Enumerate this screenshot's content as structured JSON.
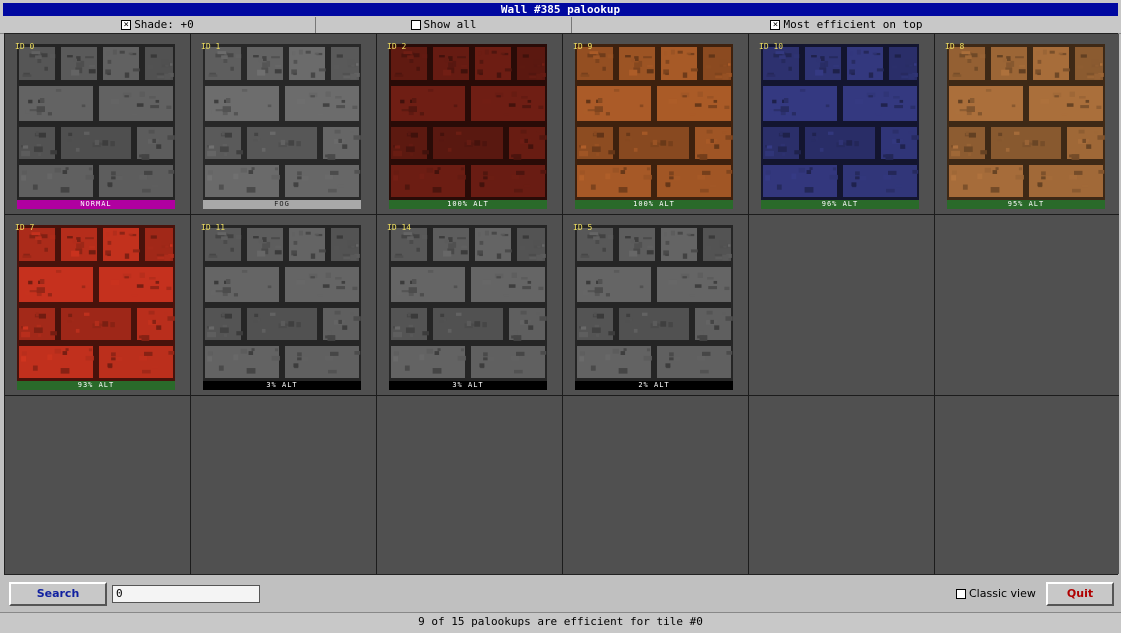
{
  "window": {
    "title": "Wall #385 palookup"
  },
  "options": {
    "shade": {
      "label": "Shade: +0",
      "checked": true
    },
    "show_all": {
      "label": "Show all",
      "checked": false
    },
    "most_efficient": {
      "label": "Most efficient on top",
      "checked": true
    }
  },
  "tiles": [
    {
      "id": "ID 0",
      "label": "NORMAL",
      "label_color": "#b000a0",
      "base": "#505050"
    },
    {
      "id": "ID 1",
      "label": "FOG",
      "label_color": "#a8a8a8",
      "base": "#585858"
    },
    {
      "id": "ID 2",
      "label": "100% ALT",
      "label_color": "#2a6a2a",
      "base": "#5a1810"
    },
    {
      "id": "ID 9",
      "label": "100% ALT",
      "label_color": "#2a6a2a",
      "base": "#8a4a20"
    },
    {
      "id": "ID 10",
      "label": "96% ALT",
      "label_color": "#2a6a2a",
      "base": "#2a2e68"
    },
    {
      "id": "ID 8",
      "label": "95% ALT",
      "label_color": "#2a6a2a",
      "base": "#8a5a30"
    },
    {
      "id": "ID 7",
      "label": "93% ALT",
      "label_color": "#2a6a2a",
      "base": "#a02818"
    },
    {
      "id": "ID 11",
      "label": "3% ALT",
      "label_color": "#000000",
      "base": "#525252"
    },
    {
      "id": "ID 14",
      "label": "3% ALT",
      "label_color": "#000000",
      "base": "#525252"
    },
    {
      "id": "ID 5",
      "label": "2% ALT",
      "label_color": "#000000",
      "base": "#525252"
    }
  ],
  "search": {
    "button_label": "Search",
    "value": "0"
  },
  "classic_view": {
    "label": "Classic view",
    "checked": false
  },
  "quit": {
    "label": "Quit"
  },
  "status": {
    "text": "9 of 15 palookups are efficient for tile #0"
  },
  "colors": {
    "title_bg": "#0008a0",
    "search_text": "#1020a0",
    "quit_text": "#b00000"
  }
}
